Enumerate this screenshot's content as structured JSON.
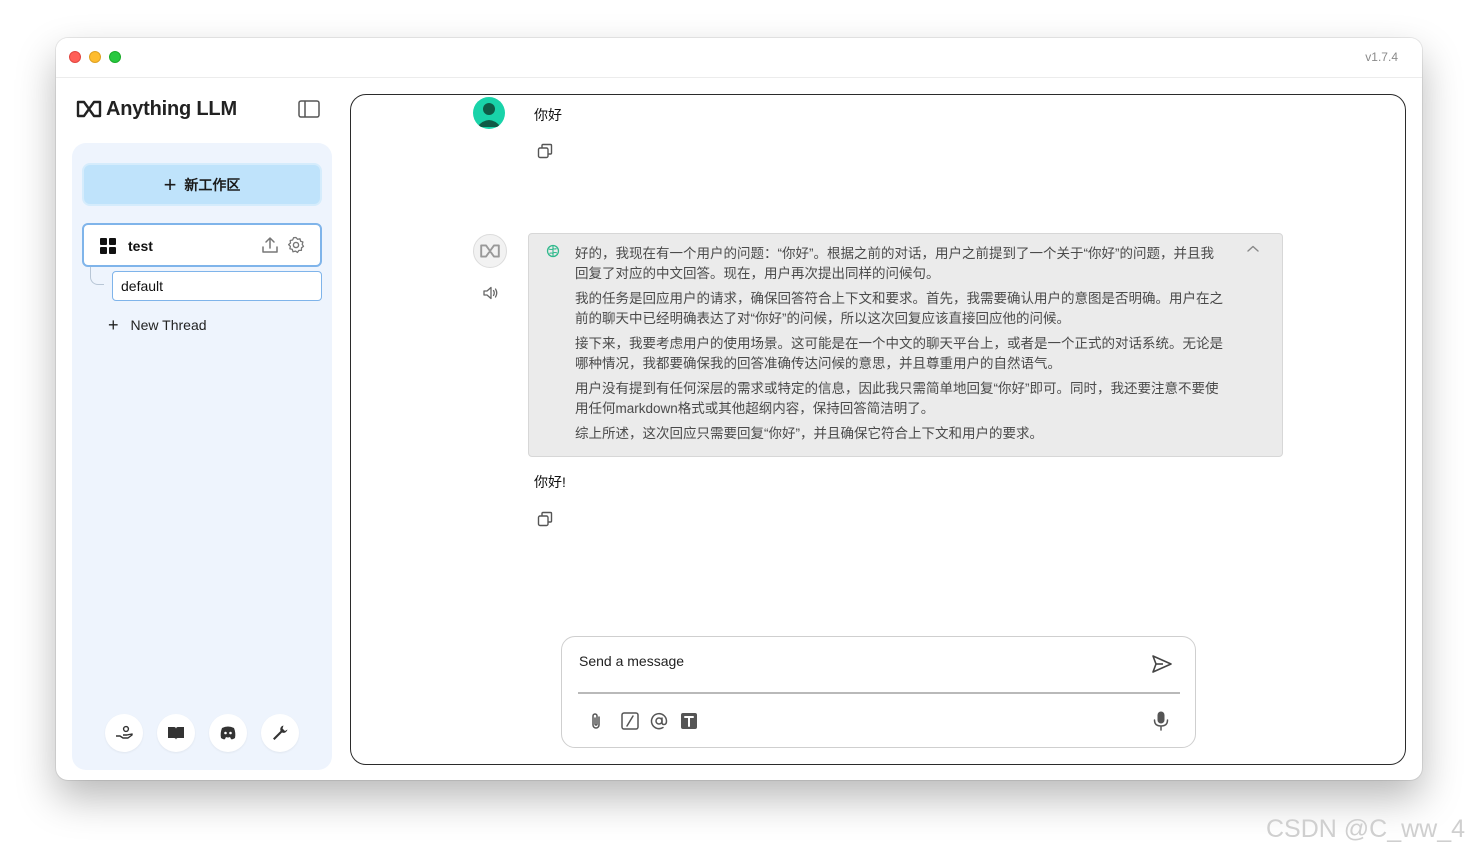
{
  "window": {
    "version": "v1.7.4"
  },
  "brand": {
    "name": "Anything LLM"
  },
  "sidebar": {
    "new_workspace_label": "新工作区",
    "workspace": {
      "name": "test"
    },
    "thread": {
      "name": "default"
    },
    "new_thread_label": "New Thread",
    "footer_icons": [
      "community-hub-icon",
      "docs-icon",
      "discord-icon",
      "settings-wrench-icon"
    ]
  },
  "chat": {
    "user_message": "你好",
    "thought": [
      "好的，我现在有一个用户的问题：“你好”。根据之前的对话，用户之前提到了一个关于“你好”的问题，并且我回复了对应的中文回答。现在，用户再次提出同样的问候句。",
      "我的任务是回应用户的请求，确保回答符合上下文和要求。首先，我需要确认用户的意图是否明确。用户在之前的聊天中已经明确表达了对“你好”的问候，所以这次回复应该直接回应他的问候。",
      "接下来，我要考虑用户的使用场景。这可能是在一个中文的聊天平台上，或者是一个正式的对话系统。无论是哪种情况，我都要确保我的回答准确传达问候的意思，并且尊重用户的自然语气。",
      "用户没有提到有任何深层的需求或特定的信息，因此我只需简单地回复“你好”即可。同时，我还要注意不要使用任何markdown格式或其他超纲内容，保持回答简洁明了。",
      "综上所述，这次回应只需要回复“你好”，并且确保它符合上下文和用户的要求。"
    ],
    "answer": "你好!"
  },
  "composer": {
    "placeholder": "Send a message"
  },
  "watermark": "CSDN @C_ww_4",
  "colors": {
    "accent": "#bfe3fb",
    "sidebar_bg": "#eef4fd",
    "selected_border": "#7fb4ea",
    "avatar": "#19d3a9"
  }
}
